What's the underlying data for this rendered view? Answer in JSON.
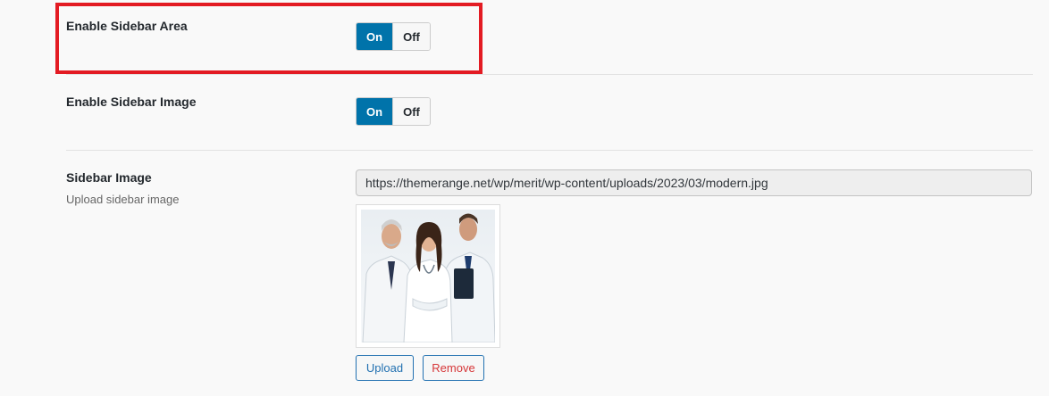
{
  "settings": {
    "sidebar_area": {
      "label": "Enable Sidebar Area",
      "on_label": "On",
      "off_label": "Off",
      "value": "On"
    },
    "sidebar_image_toggle": {
      "label": "Enable Sidebar Image",
      "on_label": "On",
      "off_label": "Off",
      "value": "On"
    },
    "sidebar_image": {
      "label": "Sidebar Image",
      "description": "Upload sidebar image",
      "url": "https://themerange.net/wp/merit/wp-content/uploads/2023/03/modern.jpg",
      "upload_label": "Upload",
      "remove_label": "Remove"
    }
  },
  "colors": {
    "highlight": "#e31b23",
    "toggle_on": "#0073aa",
    "link_blue": "#2271b1",
    "remove_red": "#d63638"
  }
}
